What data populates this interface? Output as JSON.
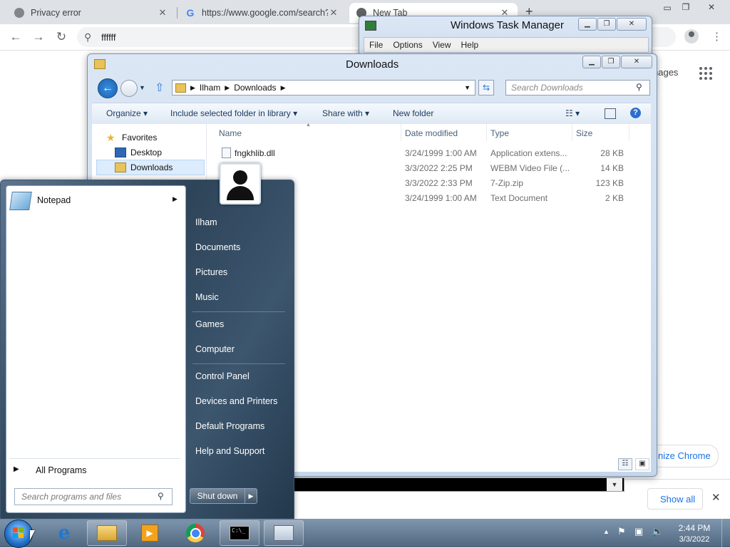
{
  "chrome": {
    "tabs": [
      {
        "title": "Privacy error",
        "close": "✕"
      },
      {
        "title": "https://www.google.com/search?",
        "close": "✕"
      },
      {
        "title": "New Tab",
        "close": "✕"
      }
    ],
    "new_tab": "+",
    "omnibox_text": "ffffff",
    "page_images_link": "nages",
    "customize_chrome": "nize Chrome",
    "show_all": "Show all",
    "download_close": "✕",
    "win_controls": {
      "minimize": "▭",
      "restore": "❐",
      "close": "✕"
    }
  },
  "taskmgr": {
    "title": "Windows Task Manager",
    "menu": [
      "File",
      "Options",
      "View",
      "Help"
    ],
    "caption": {
      "minimize": "▁",
      "restore": "❐",
      "close": "✕"
    }
  },
  "explorer": {
    "title": "Downloads",
    "caption": {
      "minimize": "▁",
      "restore": "❐",
      "close": "✕"
    },
    "breadcrumb": [
      "Ilham",
      "Downloads"
    ],
    "search_placeholder": "Search Downloads",
    "commands": {
      "organize": "Organize",
      "include": "Include selected folder in library",
      "share": "Share with",
      "new_folder": "New folder"
    },
    "nav": {
      "favorites": "Favorites",
      "desktop": "Desktop",
      "downloads": "Downloads"
    },
    "columns": {
      "name": "Name",
      "date": "Date modified",
      "type": "Type",
      "size": "Size"
    },
    "files": [
      {
        "name": "fngkhlib.dll",
        "date": "3/24/1999 1:00 AM",
        "type": "Application extens...",
        "size": "28 KB"
      },
      {
        "name": "",
        "date": "3/3/2022 2:25 PM",
        "type": "WEBM Video File (...",
        "size": "14 KB"
      },
      {
        "name": "",
        "date": "3/3/2022 2:33 PM",
        "type": "7-Zip.zip",
        "size": "123 KB"
      },
      {
        "name": "",
        "date": "3/24/1999 1:00 AM",
        "type": "Text Document",
        "size": "2 KB"
      }
    ]
  },
  "startmenu": {
    "pinned": [
      {
        "label": "Notepad"
      }
    ],
    "all_programs": "All Programs",
    "search_placeholder": "Search programs and files",
    "right": {
      "user": "Ilham",
      "documents": "Documents",
      "pictures": "Pictures",
      "music": "Music",
      "games": "Games",
      "computer": "Computer",
      "control_panel": "Control Panel",
      "devices": "Devices and Printers",
      "default_programs": "Default Programs",
      "help": "Help and Support"
    },
    "shutdown": "Shut down"
  },
  "taskbar": {
    "cmd_prompt_text": "C:\\_",
    "time": "2:44 PM",
    "date": "3/3/2022"
  }
}
